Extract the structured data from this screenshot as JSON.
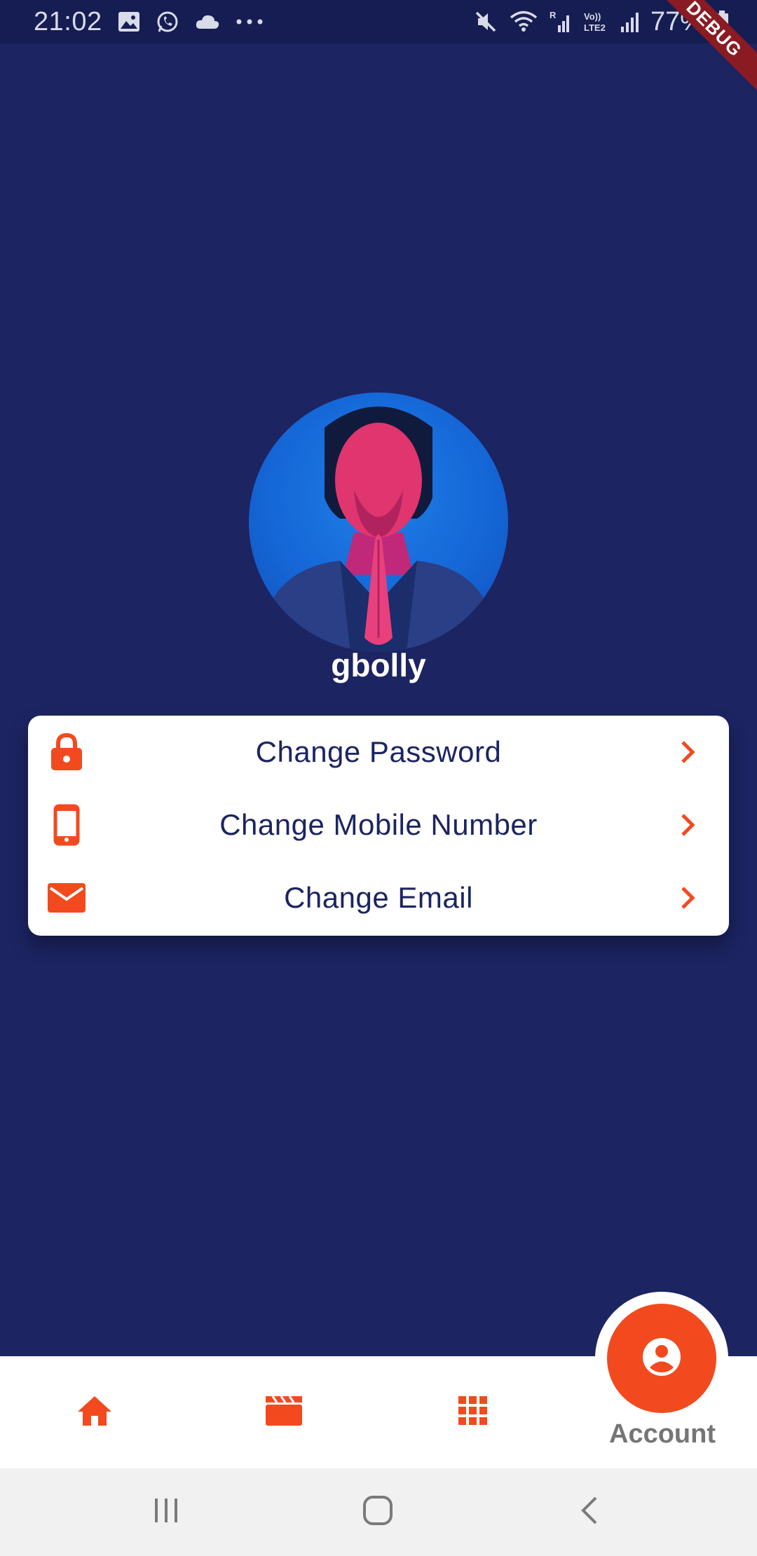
{
  "status_bar": {
    "time": "21:02",
    "battery": "77%",
    "left_icons": [
      "image-icon",
      "whatsapp-icon",
      "cloud-icon",
      "more-dots-icon"
    ],
    "right_icons": [
      "mute-icon",
      "wifi-icon",
      "signal-icon",
      "volte-icon",
      "signal-icon",
      "battery-icon"
    ],
    "volte_label": "Vo))\nLTE2",
    "roaming_label": "R"
  },
  "debug_banner": "DEBUG",
  "profile": {
    "username": "gbolly"
  },
  "settings": {
    "items": [
      {
        "label": "Change Password",
        "icon": "lock-icon"
      },
      {
        "label": "Change Mobile Number",
        "icon": "phone-icon"
      },
      {
        "label": "Change Email",
        "icon": "mail-icon"
      }
    ]
  },
  "bottom_nav": {
    "items": [
      {
        "icon": "home-icon"
      },
      {
        "icon": "clapperboard-icon"
      },
      {
        "icon": "grid-icon"
      },
      {
        "icon": "account-icon",
        "label": "Account",
        "active": true
      }
    ]
  },
  "colors": {
    "background": "#1c2462",
    "accent": "#f24a1e",
    "card": "#ffffff",
    "text_dark": "#1c2462"
  }
}
